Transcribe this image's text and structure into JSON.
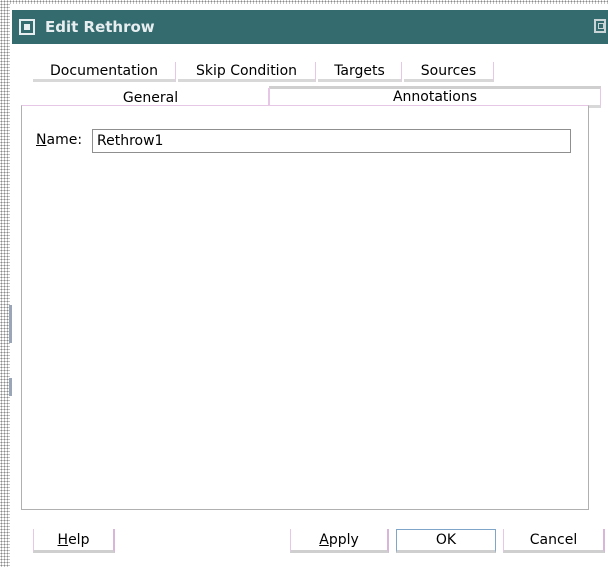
{
  "dialog": {
    "title": "Edit Rethrow",
    "title_icon": "dialog-icon",
    "maximize_icon": "maximize-icon"
  },
  "tabs_row1": [
    {
      "label": "Documentation"
    },
    {
      "label": "Skip Condition"
    },
    {
      "label": "Targets"
    },
    {
      "label": "Sources"
    }
  ],
  "tabs_row2": [
    {
      "label": "General",
      "active": true
    },
    {
      "label": "Annotations",
      "active": false
    }
  ],
  "general": {
    "name_label_mnemonic": "N",
    "name_label_rest": "ame:",
    "name_value": "Rethrow1"
  },
  "buttons": {
    "help_mnemonic": "H",
    "help_rest": "elp",
    "apply_mnemonic": "A",
    "apply_rest": "pply",
    "ok": "OK",
    "cancel": "Cancel"
  },
  "colors": {
    "titlebar": "#336b6f",
    "title_text": "#e8eef0"
  }
}
